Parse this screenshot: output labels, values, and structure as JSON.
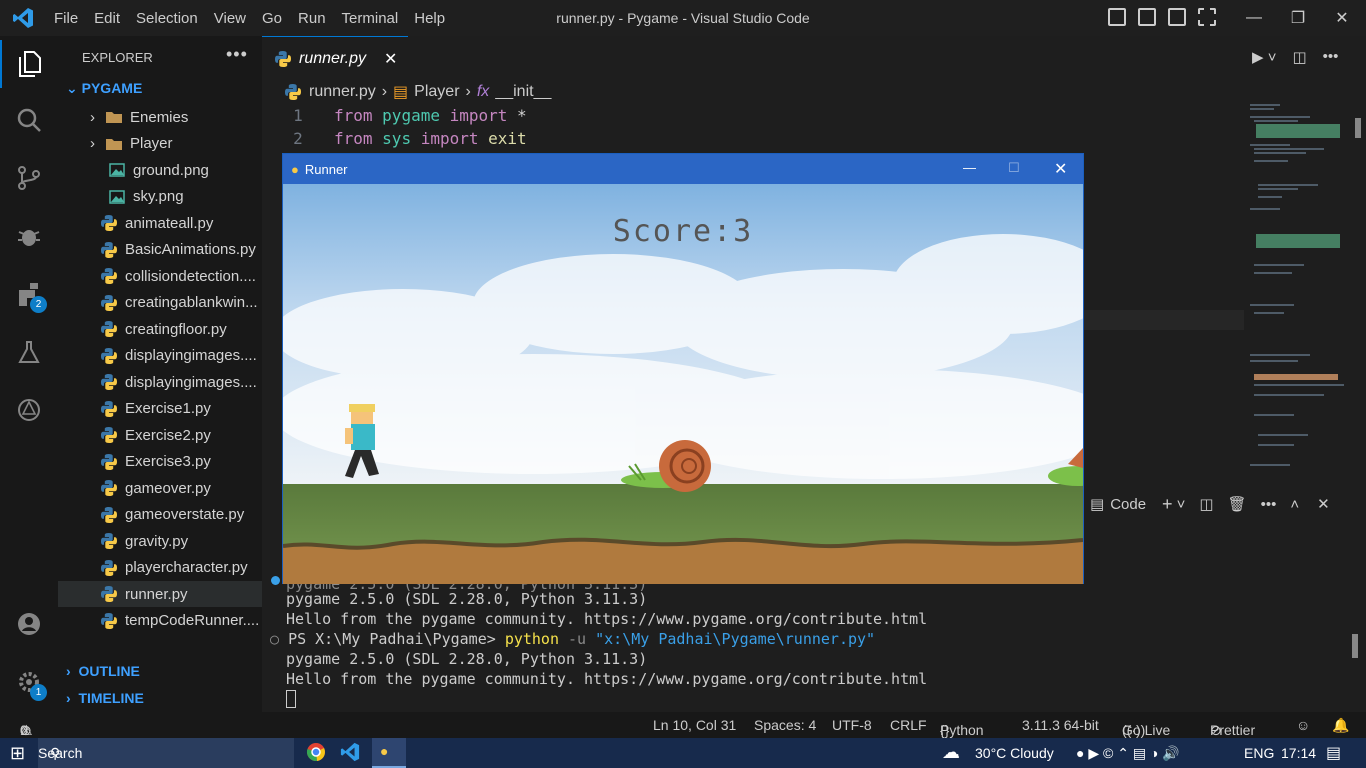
{
  "window": {
    "title": "runner.py - Pygame - Visual Studio Code"
  },
  "menu": [
    "File",
    "Edit",
    "Selection",
    "View",
    "Go",
    "Run",
    "Terminal",
    "Help"
  ],
  "activity": {
    "extensions_badge": "2",
    "settings_badge": "1"
  },
  "explorer": {
    "title": "EXPLORER",
    "project": "PYGAME",
    "folders": [
      "Enemies",
      "Player"
    ],
    "images": [
      "ground.png",
      "sky.png"
    ],
    "files": [
      "animateall.py",
      "BasicAnimations.py",
      "collisiondetection....",
      "creatingablankwin...",
      "creatingfloor.py",
      "displayingimages....",
      "displayingimages....",
      "Exercise1.py",
      "Exercise2.py",
      "Exercise3.py",
      "gameover.py",
      "gameoverstate.py",
      "gravity.py",
      "playercharacter.py",
      "runner.py",
      "tempCodeRunner...."
    ],
    "outline": "OUTLINE",
    "timeline": "TIMELINE"
  },
  "editor": {
    "tab": "runner.py",
    "breadcrumb": {
      "file": "runner.py",
      "class": "Player",
      "func": "__init__"
    },
    "lines": [
      {
        "n": "1",
        "kw1": "from",
        "mod": "pygame",
        "kw2": "import",
        "rest": "*"
      },
      {
        "n": "2",
        "kw1": "from",
        "mod": "sys",
        "kw2": "import",
        "rest": "exit"
      }
    ]
  },
  "pygame_window": {
    "title": "Runner",
    "score": "Score:3"
  },
  "terminal": {
    "label": "Code",
    "partial": "pygame 2.5.0 (SDL 2.28.0, Python 3.11.3)",
    "hello1": "Hello from the pygame community. https://www.pygame.org/contribute.html",
    "prompt": "PS X:\\My Padhai\\Pygame>",
    "cmd": "python",
    "flag": "-u",
    "path": "\"x:\\My Padhai\\Pygame\\runner.py\"",
    "ver2": "pygame 2.5.0 (SDL 2.28.0, Python 3.11.3)",
    "hello2": "Hello from the pygame community. https://www.pygame.org/contribute.html"
  },
  "status": {
    "errors": "0",
    "warnings": "0",
    "position": "Ln 10, Col 31",
    "spaces": "Spaces: 4",
    "encoding": "UTF-8",
    "eol": "CRLF",
    "language": "Python",
    "interpreter": "3.11.3 64-bit",
    "golive": "Go Live",
    "prettier": "Prettier"
  },
  "taskbar": {
    "search": "Search",
    "weather": "30°C  Cloudy",
    "lang": "ENG",
    "time": "17:14"
  }
}
